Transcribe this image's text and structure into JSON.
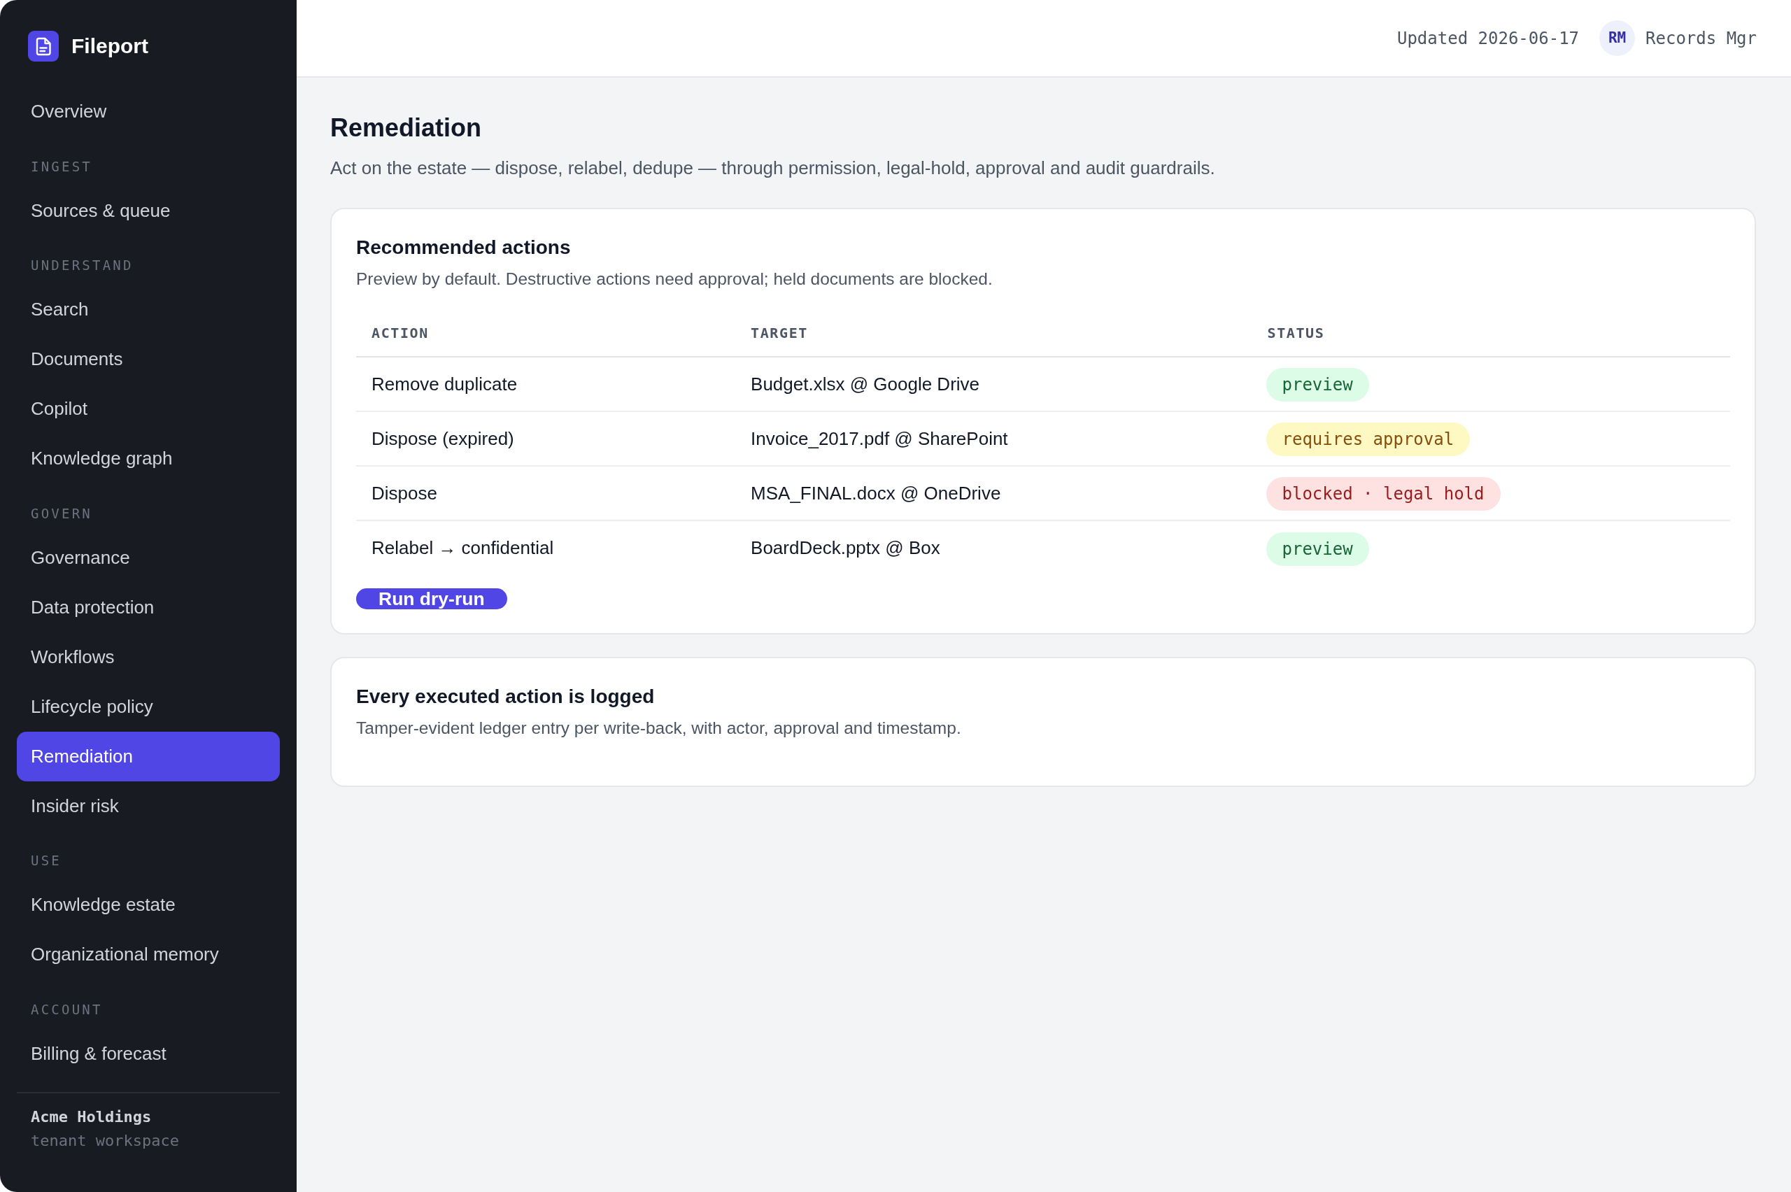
{
  "sidebar": {
    "brand": "Fileport",
    "sections": [
      {
        "items": [
          {
            "label": "Overview",
            "selected": false
          }
        ]
      },
      {
        "heading": "INGEST",
        "items": [
          {
            "label": "Sources & queue",
            "selected": false
          }
        ]
      },
      {
        "heading": "UNDERSTAND",
        "items": [
          {
            "label": "Search",
            "selected": false
          },
          {
            "label": "Documents",
            "selected": false
          },
          {
            "label": "Copilot",
            "selected": false
          },
          {
            "label": "Knowledge graph",
            "selected": false
          }
        ]
      },
      {
        "heading": "GOVERN",
        "items": [
          {
            "label": "Governance",
            "selected": false
          },
          {
            "label": "Data protection",
            "selected": false
          },
          {
            "label": "Workflows",
            "selected": false
          },
          {
            "label": "Lifecycle policy",
            "selected": false
          },
          {
            "label": "Remediation",
            "selected": true
          },
          {
            "label": "Insider risk",
            "selected": false
          }
        ]
      },
      {
        "heading": "USE",
        "items": [
          {
            "label": "Knowledge estate",
            "selected": false
          },
          {
            "label": "Organizational memory",
            "selected": false
          }
        ]
      },
      {
        "heading": "ACCOUNT",
        "items": [
          {
            "label": "Billing & forecast",
            "selected": false
          }
        ]
      }
    ],
    "footer": {
      "organization": "Acme Holdings",
      "workspace": "tenant workspace"
    }
  },
  "top_bar": {
    "updated": "Updated 2026-06-17",
    "user": {
      "initials": "RM",
      "name": "Records Mgr"
    }
  },
  "page": {
    "title": "Remediation",
    "description": "Act on the estate — dispose, relabel, dedupe — through permission, legal-hold, approval and audit guardrails."
  },
  "recommended_actions": {
    "title": "Recommended actions",
    "description": "Preview by default. Destructive actions need approval; held documents are blocked.",
    "table": {
      "columns": [
        "ACTION",
        "TARGET",
        "STATUS"
      ],
      "rows": [
        {
          "action": "Remove duplicate",
          "target": "Budget.xlsx @ Google Drive",
          "status": {
            "label": "preview",
            "kind": "ok"
          }
        },
        {
          "action": "Dispose (expired)",
          "target": "Invoice_2017.pdf @ SharePoint",
          "status": {
            "label": "requires approval",
            "kind": "warning"
          }
        },
        {
          "action": "Dispose",
          "target": "MSA_FINAL.docx @ OneDrive",
          "status": {
            "label": "blocked · legal hold",
            "kind": "danger"
          }
        },
        {
          "action": "Relabel → confidential",
          "target": "BoardDeck.pptx @ Box",
          "status": {
            "label": "preview",
            "kind": "ok"
          }
        }
      ]
    },
    "button": {
      "label": "Run dry-run"
    }
  },
  "audit_note": {
    "title": "Every executed action is logged",
    "description": "Tamper-evident ledger entry per write-back, with actor, approval and timestamp."
  }
}
